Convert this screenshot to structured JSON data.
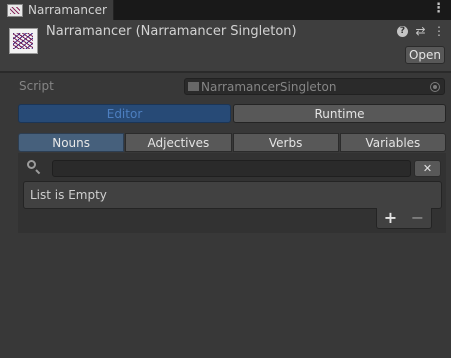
{
  "window": {
    "tab_title": "Narramancer",
    "menu_icon": "kebab-menu-icon"
  },
  "header": {
    "title": "Narramancer (Narramancer Singleton)",
    "open_label": "Open",
    "icons": [
      "help-icon",
      "settings-sliders-icon",
      "more-vert-icon"
    ]
  },
  "script": {
    "label": "Script",
    "value": "NarramancerSingleton"
  },
  "mode_toggle": {
    "editor_label": "Editor",
    "runtime_label": "Runtime",
    "selected": "Editor"
  },
  "tabs": [
    {
      "label": "Nouns",
      "selected": true
    },
    {
      "label": "Adjectives",
      "selected": false
    },
    {
      "label": "Verbs",
      "selected": false
    },
    {
      "label": "Variables",
      "selected": false
    }
  ],
  "list": {
    "search_value": "",
    "clear_label": "✕",
    "empty_text": "List is Empty",
    "add_label": "+",
    "remove_label": "−"
  },
  "colors": {
    "background": "#383838",
    "accent_selected": "#274a76",
    "tab_selected": "#46607c"
  }
}
